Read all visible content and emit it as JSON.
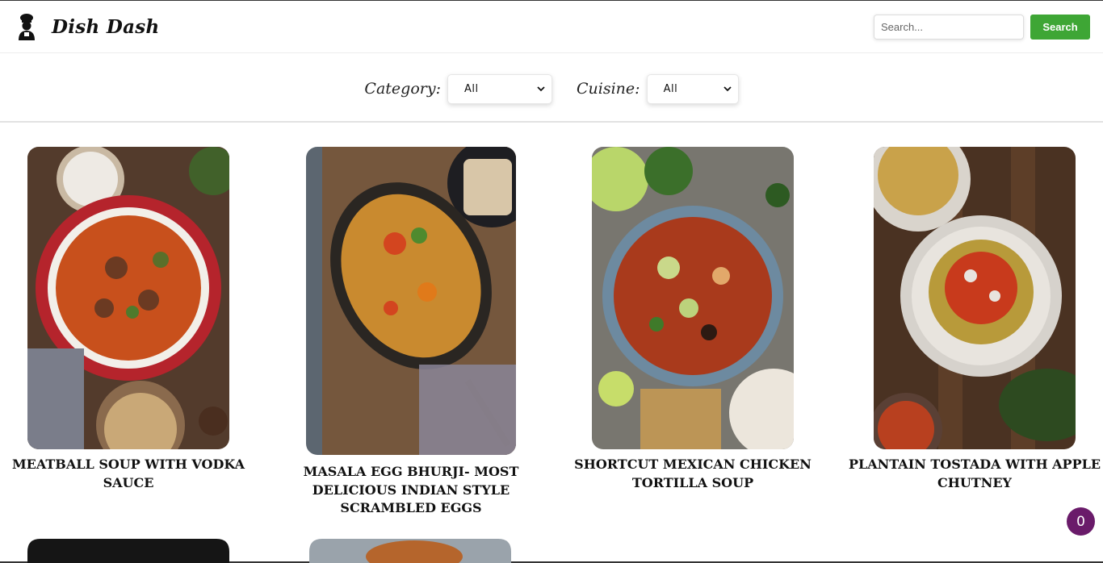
{
  "header": {
    "brand": "Dish Dash",
    "logo_icon": "chef-icon",
    "search_placeholder": "Search...",
    "search_button": "Search"
  },
  "filters": {
    "category_label": "Category:",
    "category_value": "All",
    "cuisine_label": "Cuisine:",
    "cuisine_value": "All"
  },
  "recipes": [
    {
      "title": "MEATBALL SOUP WITH VODKA SAUCE"
    },
    {
      "title": "MASALA EGG BHURJI- MOST DELICIOUS INDIAN STYLE SCRAMBLED EGGS"
    },
    {
      "title": "SHORTCUT MEXICAN CHICKEN TORTILLA SOUP"
    },
    {
      "title": "PLANTAIN TOSTADA WITH APPLE CHUTNEY"
    }
  ],
  "cart": {
    "count": "0"
  },
  "colors": {
    "accent": "#3ea635",
    "badge": "#6a1b6a"
  }
}
